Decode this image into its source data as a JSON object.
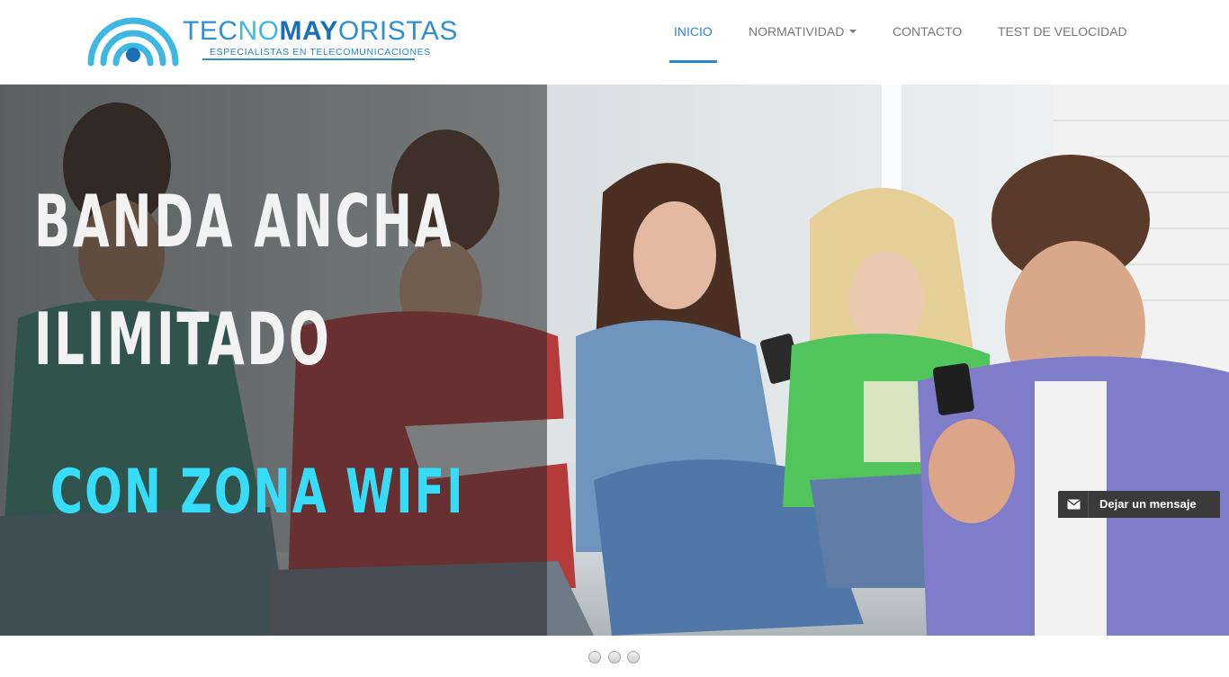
{
  "brand": {
    "name_part1": "TEC",
    "name_part2": "NO",
    "name_part3": "MAY",
    "name_part4": "ORISTAS",
    "tagline": "ESPECIALISTAS EN TELECOMUNICACIONES",
    "colors": {
      "primary": "#2f8fd1",
      "light": "#3fb7e3",
      "dark": "#1b6fb6"
    }
  },
  "nav": {
    "items": [
      {
        "label": "INICIO",
        "active": true
      },
      {
        "label": "NORMATIVIDAD",
        "dropdown": true
      },
      {
        "label": "CONTACTO"
      },
      {
        "label": "TEST DE VELOCIDAD"
      }
    ],
    "accent": "#2a86c9"
  },
  "hero": {
    "headline_line1": "BANDA ANCHA",
    "headline_line2": "ILIMITADO",
    "subheadline": "CON ZONA WIFI",
    "subheadline_color": "#37dcf8"
  },
  "chat": {
    "label": "Dejar un mensaje",
    "icon": "envelope-icon"
  },
  "carousel": {
    "slide_count": 3
  }
}
